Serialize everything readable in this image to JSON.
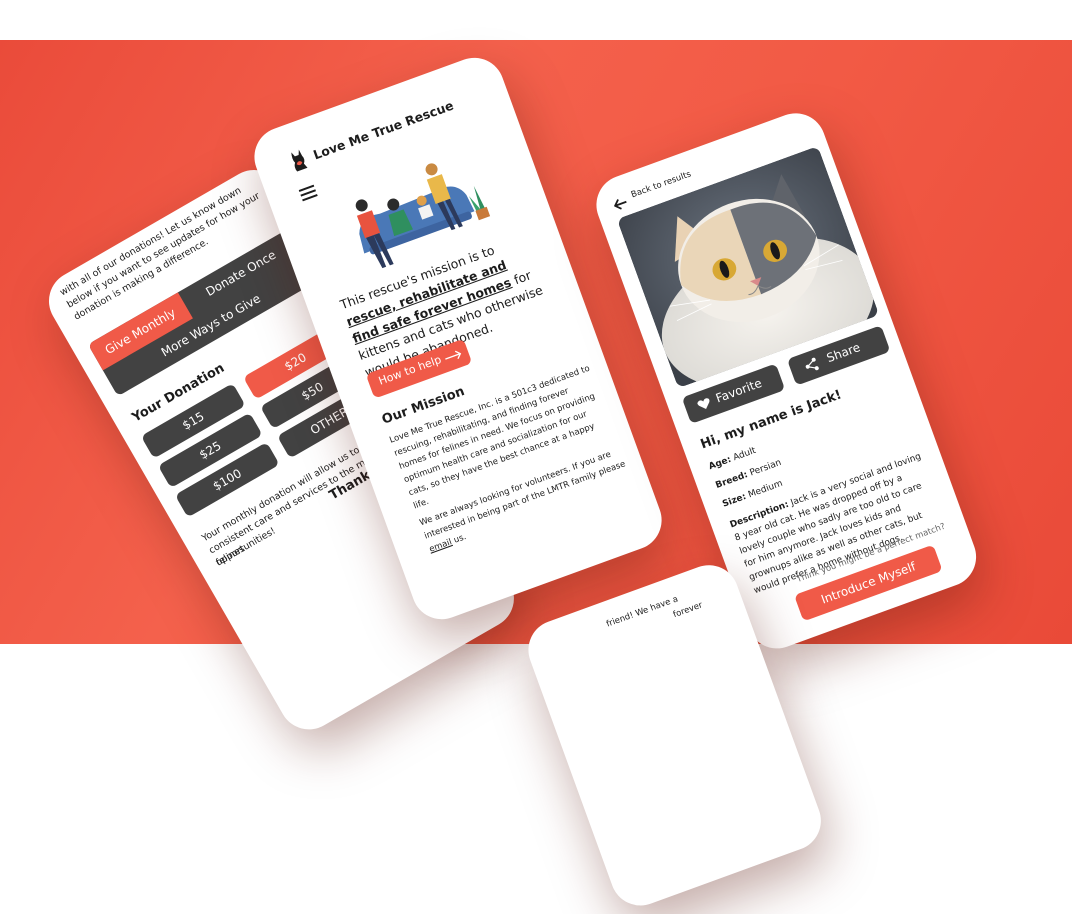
{
  "colors": {
    "brand_red": "#f05a48",
    "dark_button": "#424242",
    "background": "#f25a45"
  },
  "donation_screen": {
    "intro": "with all of our donations! Let us know down below if you want to see updates for how your donation is making a difference.",
    "tabs": {
      "give_monthly": "Give Monthly",
      "donate_once": "Donate Once",
      "more_ways": "More Ways to Give"
    },
    "heading": "Your Donation",
    "amounts": {
      "a15": "$15",
      "a20": "$20",
      "a25": "$25",
      "a50": "$50",
      "a100": "$100",
      "other": "OTHER"
    },
    "monthly_note": "Your monthly donation will allow us to provide consistent care and services to the many felines",
    "note_tail": "opportunities!",
    "thank_you": "Thank You"
  },
  "home_screen": {
    "logo_text": "Love Me True Rescue",
    "logo_icon": "cat-logo-icon",
    "menu_icon": "hamburger-menu-icon",
    "mission_plain_1": "This rescue's mission is to",
    "mission_bold": "rescue, rehabilitate and find safe forever homes",
    "mission_plain_2": "for kittens and cats who otherwise would be abandoned.",
    "how_to_help": "How to help",
    "arrow_icon": "arrow-right-icon",
    "our_mission_heading": "Our Mission",
    "our_mission_body": "Love Me True Rescue, Inc. is a 501c3 dedicated to rescuing, rehabilitating, and finding forever homes for felines in need. We focus on providing optimum health care and socialization for our cats, so they have the best chance at a happy life.",
    "volunteer_text": "We are always looking for volunteers. If you are interested in being part of the LMTR family please",
    "email_link": "email",
    "volunteer_end": "us."
  },
  "profile_screen": {
    "back": "Back to results",
    "favorite": "Favorite",
    "share": "Share",
    "title": "Hi, my name is Jack!",
    "age_label": "Age:",
    "age_value": "Adult",
    "breed_label": "Breed:",
    "breed_value": "Persian",
    "size_label": "Size:",
    "size_value": "Medium",
    "description_label": "Description:",
    "description_value": "Jack is a very social and loving 8 year old cat. He was dropped off by a lovely couple who sadly are too old to care for him anymore. Jack loves kids and grownups alike as well as other cats, but would prefer a home without dogs.",
    "perfect_match": "Think you might be a perfect match?",
    "introduce": "Introduce Myself"
  },
  "bottom_screen": {
    "snippet": "friend! We have a",
    "snippet2": "forever"
  }
}
